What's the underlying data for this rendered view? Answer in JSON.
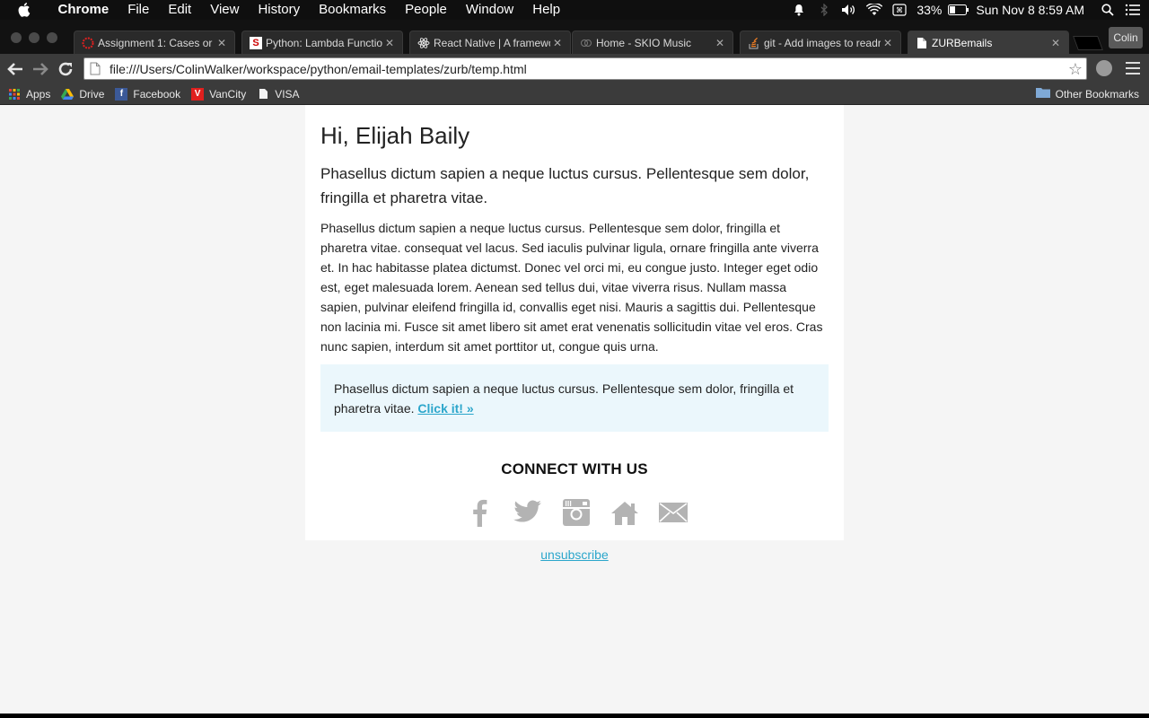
{
  "menubar": {
    "app_name": "Chrome",
    "items": [
      "File",
      "Edit",
      "View",
      "History",
      "Bookmarks",
      "People",
      "Window",
      "Help"
    ],
    "battery": "33%",
    "datetime": "Sun Nov 8  8:59 AM"
  },
  "tabs": [
    {
      "title": "Assignment 1: Cases or",
      "icon": "red-ring-icon"
    },
    {
      "title": "Python: Lambda Functio",
      "icon": "s-logo-icon"
    },
    {
      "title": "React Native | A framewo",
      "icon": "react-atom-icon"
    },
    {
      "title": "Home - SKIO Music",
      "icon": "skio-icon"
    },
    {
      "title": "git - Add images to readr",
      "icon": "stackoverflow-icon"
    },
    {
      "title": "ZURBemails",
      "icon": "document-icon",
      "active": true
    }
  ],
  "profile_name": "Colin",
  "address_bar": {
    "url": "file:///Users/ColinWalker/workspace/python/email-templates/zurb/temp.html"
  },
  "bookmarks": {
    "items": [
      {
        "label": "Apps",
        "icon": "apps-grid-icon"
      },
      {
        "label": "Drive",
        "icon": "drive-icon"
      },
      {
        "label": "Facebook",
        "icon": "facebook-icon"
      },
      {
        "label": "VanCity",
        "icon": "vancity-icon"
      },
      {
        "label": "VISA",
        "icon": "document-icon"
      }
    ],
    "other": "Other Bookmarks"
  },
  "email": {
    "greeting": "Hi, Elijah Baily",
    "lead": "Phasellus dictum sapien a neque luctus cursus. Pellentesque sem dolor, fringilla et pharetra vitae.",
    "body": "Phasellus dictum sapien a neque luctus cursus. Pellentesque sem dolor, fringilla et pharetra vitae. consequat vel lacus. Sed iaculis pulvinar ligula, ornare fringilla ante viverra et. In hac habitasse platea dictumst. Donec vel orci mi, eu congue justo. Integer eget odio est, eget malesuada lorem. Aenean sed tellus dui, vitae viverra risus. Nullam massa sapien, pulvinar eleifend fringilla id, convallis eget nisi. Mauris a sagittis dui. Pellentesque non lacinia mi. Fusce sit amet libero sit amet erat venenatis sollicitudin vitae vel eros. Cras nunc sapien, interdum sit amet porttitor ut, congue quis urna.",
    "callout_text": "Phasellus dictum sapien a neque luctus cursus. Pellentesque sem dolor, fringilla et pharetra vitae.",
    "callout_link": "Click it! »",
    "connect_heading": "CONNECT WITH US",
    "social_icons": [
      "facebook-icon",
      "twitter-icon",
      "instagram-icon",
      "home-icon",
      "mail-icon"
    ],
    "unsubscribe": "unsubscribe"
  },
  "colors": {
    "link": "#2ba6cb",
    "callout_bg": "#ebf7fc",
    "page_bg": "#f5f5f5",
    "social_icon": "#b3b3b3"
  }
}
